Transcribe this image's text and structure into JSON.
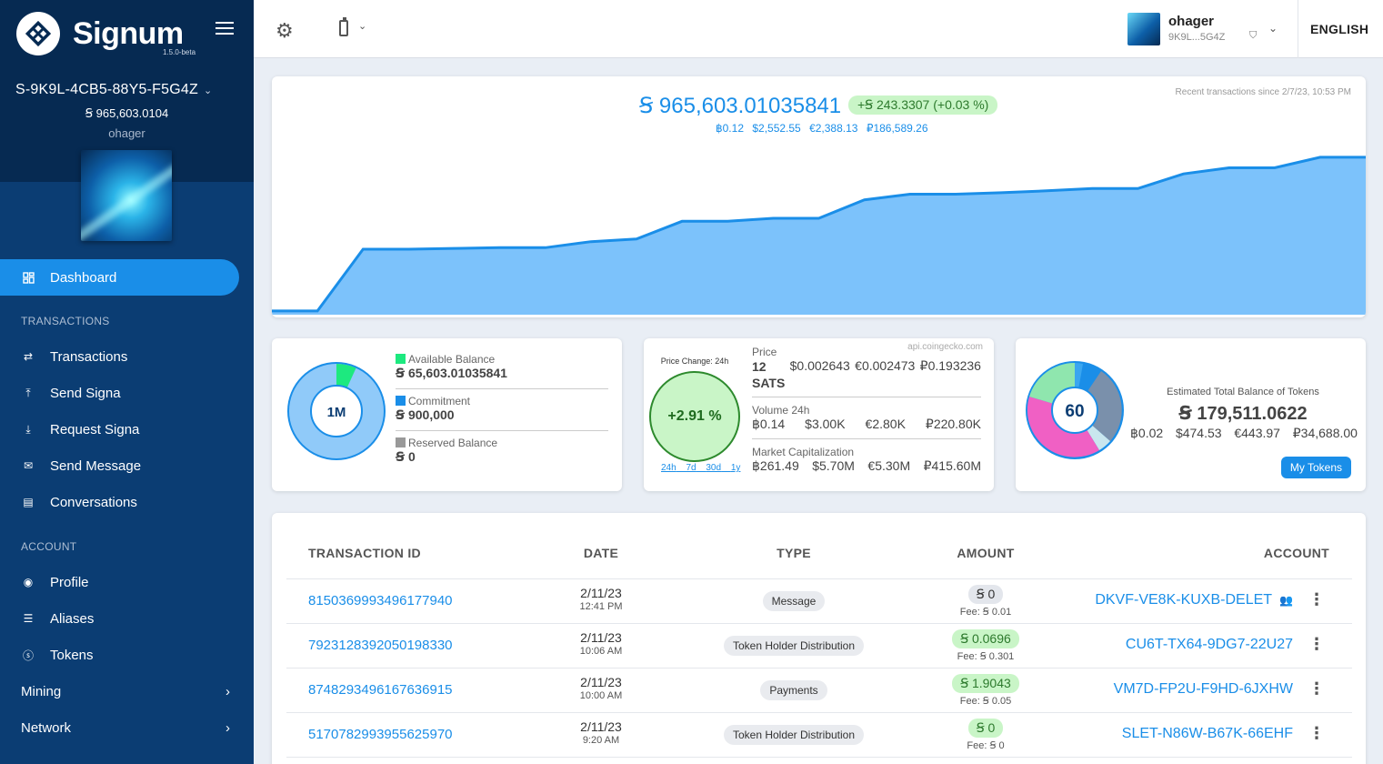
{
  "sidebar": {
    "brand": "Signum",
    "version": "1.5.0-beta",
    "account_id": "S-9K9L-4CB5-88Y5-F5G4Z",
    "account_balance": "Ꞩ 965,603.0104",
    "account_name": "ohager",
    "nav": {
      "dashboard": "Dashboard",
      "transactions_head": "TRANSACTIONS",
      "transactions": "Transactions",
      "send_signa": "Send Signa",
      "request_signa": "Request Signa",
      "send_message": "Send Message",
      "conversations": "Conversations",
      "account_head": "ACCOUNT",
      "profile": "Profile",
      "aliases": "Aliases",
      "tokens": "Tokens",
      "mining": "Mining",
      "network": "Network"
    }
  },
  "topbar": {
    "user_name": "ohager",
    "user_short": "9K9L...5G4Z",
    "language": "ENGLISH"
  },
  "balance_chart": {
    "balance": "Ꞩ 965,603.01035841",
    "change": "+Ꞩ 243.3307 (+0.03 %)",
    "fiat_btc": "฿0.12",
    "fiat_usd": "$2,552.55",
    "fiat_eur": "€2,388.13",
    "fiat_rub": "₽186,589.26",
    "recent_label": "Recent transactions since 2/7/23, 10:53 PM"
  },
  "chart_data": {
    "type": "area",
    "series": [
      {
        "values": [
          1.0,
          1.0,
          17.4,
          17.4,
          17.6,
          17.8,
          17.8,
          19.4,
          20.1,
          24.8,
          24.8,
          25.6,
          25.6,
          30.5,
          32.0,
          32.0,
          32.4,
          32.9,
          33.5,
          33.5,
          37.4,
          39.0,
          39.0,
          41.8,
          41.8
        ]
      }
    ],
    "color": "#7cc2fb",
    "line_color": "#1a8ee8"
  },
  "balances": {
    "center": "1M",
    "available_label": "Available Balance",
    "available_value": "Ꞩ 65,603.01035841",
    "commitment_label": "Commitment",
    "commitment_value": "Ꞩ 900,000",
    "reserved_label": "Reserved Balance",
    "reserved_value": "Ꞩ 0",
    "available_fraction": 0.068,
    "color_available": "#1de97f",
    "color_commitment": "#1a8ee8",
    "color_reserved": "#999999"
  },
  "market": {
    "price_change_label": "Price Change: 24h",
    "price_change": "+2.91 %",
    "periods": [
      "24h",
      "7d",
      "30d",
      "1y"
    ],
    "source": "api.coingecko.com",
    "price_label": "Price",
    "price_sats": "12",
    "price_sats_unit": "SATS",
    "price_usd": "$0.002643",
    "price_eur": "€0.002473",
    "price_rub": "₽0.193236",
    "volume_label": "Volume 24h",
    "volume_btc": "฿0.14",
    "volume_usd": "$3.00K",
    "volume_eur": "€2.80K",
    "volume_rub": "₽220.80K",
    "cap_label": "Market Capitalization",
    "cap_btc": "฿261.49",
    "cap_usd": "$5.70M",
    "cap_eur": "€5.30M",
    "cap_rub": "₽415.60M"
  },
  "tokens": {
    "count": "60",
    "title": "Estimated Total Balance of Tokens",
    "total": "Ꞩ 179,511.0622",
    "btc": "฿0.02",
    "usd": "$474.53",
    "eur": "€443.97",
    "rub": "₽34,688.00",
    "button": "My Tokens"
  },
  "table": {
    "headers": [
      "TRANSACTION ID",
      "DATE",
      "TYPE",
      "AMOUNT",
      "ACCOUNT"
    ],
    "rows": [
      {
        "id": "8150369993496177940",
        "date": "2/11/23",
        "time": "12:41 PM",
        "type": "Message",
        "amount": "Ꞩ 0",
        "fee": "Fee: Ꞩ 0.01",
        "account": "DKVF-VE8K-KUXB-DELET"
      },
      {
        "id": "7923128392050198330",
        "date": "2/11/23",
        "time": "10:06 AM",
        "type": "Token Holder Distribution",
        "amount": "Ꞩ 0.0696",
        "fee": "Fee: Ꞩ 0.301",
        "account": "CU6T-TX64-9DG7-22U27"
      },
      {
        "id": "8748293496167636915",
        "date": "2/11/23",
        "time": "10:00 AM",
        "type": "Payments",
        "amount": "Ꞩ 1.9043",
        "fee": "Fee: Ꞩ 0.05",
        "account": "VM7D-FP2U-F9HD-6JXHW"
      },
      {
        "id": "5170782993955625970",
        "date": "2/11/23",
        "time": "9:20 AM",
        "type": "Token Holder Distribution",
        "amount": "Ꞩ 0",
        "fee": "Fee: Ꞩ 0",
        "account": "SLET-N86W-B67K-66EHF"
      }
    ]
  }
}
